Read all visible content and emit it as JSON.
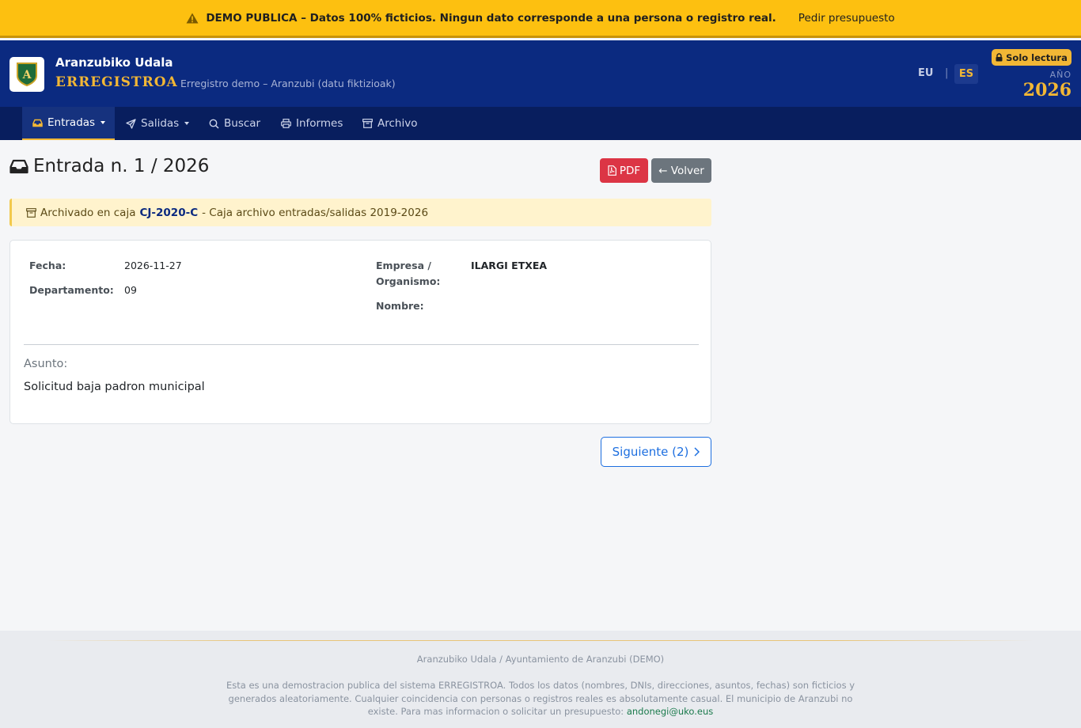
{
  "banner": {
    "text": "DEMO PUBLICA – Datos 100% ficticios. Ningun dato corresponde a una persona o registro real.",
    "link": "Pedir presupuesto"
  },
  "header": {
    "logo_letter": "A",
    "org_name": "Aranzubiko Udala",
    "app_title": "ERREGISTROA",
    "subtitle": "Erregistro demo – Aranzubi (datu fiktizioak)",
    "lang_eu": "EU",
    "lang_sep": "|",
    "lang_es": "ES",
    "readonly_badge": "Solo lectura",
    "year_label": "AÑO",
    "year": "2026"
  },
  "nav": {
    "items": [
      {
        "label": "Entradas",
        "icon": "inbox-icon"
      },
      {
        "label": "Salidas",
        "icon": "paper-plane-icon"
      },
      {
        "label": "Buscar",
        "icon": "search-icon"
      },
      {
        "label": "Informes",
        "icon": "printer-icon"
      },
      {
        "label": "Archivo",
        "icon": "archive-icon"
      }
    ]
  },
  "page": {
    "title": "Entrada n. 1 / 2026",
    "pdf_button": "PDF",
    "back_button": "← Volver",
    "archive": {
      "prefix": "Archivado en caja",
      "code": "CJ-2020-C",
      "suffix": "- Caja archivo entradas/salidas 2019-2026"
    },
    "fields": {
      "fecha_label": "Fecha:",
      "fecha_value": "2026-11-27",
      "departamento_label": "Departamento:",
      "departamento_value": "09",
      "empresa_label_1": "Empresa /",
      "empresa_label_2": "Organismo:",
      "empresa_value": "ILARGI ETXEA",
      "nombre_label": "Nombre:"
    },
    "asunto_label": "Asunto:",
    "asunto_value": "Solicitud baja padron municipal",
    "next_button": "Siguiente (2)"
  },
  "footer": {
    "org": "Aranzubiko Udala / Ayuntamiento de Aranzubi (DEMO)",
    "note": "Esta es una demostracion publica del sistema ERREGISTROA. Todos los datos (nombres, DNIs, direcciones, asuntos, fechas) son ficticios y generados aleatoriamente. Cualquier coincidencia con personas o registros reales es absolutamente casual. El municipio de Aranzubi no existe. Para mas informacion o solicitar un presupuesto:",
    "email": "andonegi@uko.eus"
  },
  "colors": {
    "banner": "#fdc010",
    "header": "#0b2a80",
    "nav": "#081e5e",
    "accent_gold": "#f2b735",
    "pdf_button": "#dc3545",
    "back_button": "#6c757d",
    "link_blue": "#1d6fe0"
  }
}
